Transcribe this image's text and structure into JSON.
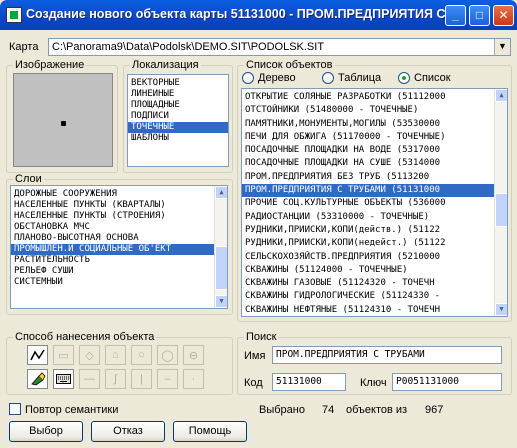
{
  "window": {
    "title": "Создание нового объекта карты 51131000 - ПРОМ.ПРЕДПРИЯТИЯ С ..."
  },
  "map": {
    "label": "Карта",
    "value": "C:\\Panorama9\\Data\\Podolsk\\DEMO.SIT\\PODOLSK.SIT"
  },
  "image_group": {
    "label": "Изображение"
  },
  "localization": {
    "label": "Локализация",
    "items": [
      "ВЕКТОРНЫЕ",
      "ЛИНЕЙНЫЕ",
      "ПЛОЩАДНЫЕ",
      "ПОДПИСИ",
      "ТОЧЕЧНЫЕ",
      "ШАБЛОНЫ"
    ],
    "selected": 4
  },
  "layers": {
    "label": "Слои",
    "items": [
      "ДОРОЖНЫЕ СООРУЖЕНИЯ",
      "НАСЕЛЕННЫЕ ПУНКТЫ (КВАРТАЛЫ)",
      "НАСЕЛЕННЫЕ ПУНКТЫ (СТРОЕНИЯ)",
      "ОБСТАНОВКА МЧС",
      "ПЛАНОВО-ВЫСОТНАЯ ОСНОВА",
      "ПРОМЫШЛЕН.И СОЦИАЛЬНЫЕ ОБ'ЕКТ",
      "РАСТИТЕЛЬНОСТЬ",
      "РЕЛЬЕФ СУШИ",
      "СИСТЕМНЫЙ"
    ],
    "selected": 5
  },
  "objects": {
    "label": "Список объектов",
    "view_options": [
      "Дерево",
      "Таблица",
      "Список"
    ],
    "view_selected": 2,
    "items": [
      "ОТКРЫТИЕ СОЛЯНЫЕ РАЗРАБОТКИ (51112000",
      "ОТСТОЙНИКИ (51480000 - ТОЧЕЧНЫЕ)",
      "ПАМЯТНИКИ,МОНУМЕНТЫ,МОГИЛЫ (53530000",
      "ПЕЧИ ДЛЯ ОБЖИГА (51170000 - ТОЧЕЧНЫЕ)",
      "ПОСАДОЧНЫЕ ПЛОЩАДКИ НА ВОДЕ (5317000",
      "ПОСАДОЧНЫЕ ПЛОЩАДКИ НА СУШЕ (5314000",
      "ПРОМ.ПРЕДПРИЯТИЯ БЕЗ ТРУБ (5113200",
      "ПРОМ.ПРЕДПРИЯТИЯ С ТРУБАМИ (51131000",
      "ПРОЧИЕ СОЦ.КУЛЬТУРНЫЕ ОБЪЕКТЫ (536000",
      "РАДИОСТАНЦИИ (53310000 - ТОЧЕЧНЫЕ)",
      "РУДНИКИ,ПРИИСКИ,КОПИ(действ.) (51122",
      "РУДНИКИ,ПРИИСКИ,КОПИ(недейст.) (51122",
      "СЕЛЬСКОХОЗЯЙСТВ.ПРЕДПРИЯТИЯ (5210000",
      "СКВАЖИНЫ (51124000 - ТОЧЕЧНЫЕ)",
      "СКВАЖИНЫ ГАЗОВЫЕ (51124320 - ТОЧЕЧН",
      "СКВАЖИНЫ ГИДРОЛОГИЧЕСКИЕ (51124330 -",
      "СКВАЖИНЫ НЕФТЯНЫЕ (51124310 - ТОЧЕЧН"
    ],
    "selected": 7
  },
  "drawing_method": {
    "label": "Способ нанесения объекта"
  },
  "search": {
    "label": "Поиск",
    "name_label": "Имя",
    "name_value": "ПРОМ.ПРЕДПРИЯТИЯ С ТРУБАМИ",
    "code_label": "Код",
    "code_value": "51131000",
    "key_label": "Ключ",
    "key_value": "P0051131000"
  },
  "repeat_semantics": {
    "label": "Повтор семантики",
    "checked": false
  },
  "stats": {
    "selected_label": "Выбрано",
    "selected_value": "74",
    "total_label": "объектов из",
    "total_value": "967"
  },
  "buttons": {
    "select": "Выбор",
    "cancel": "Отказ",
    "help": "Помощь"
  }
}
